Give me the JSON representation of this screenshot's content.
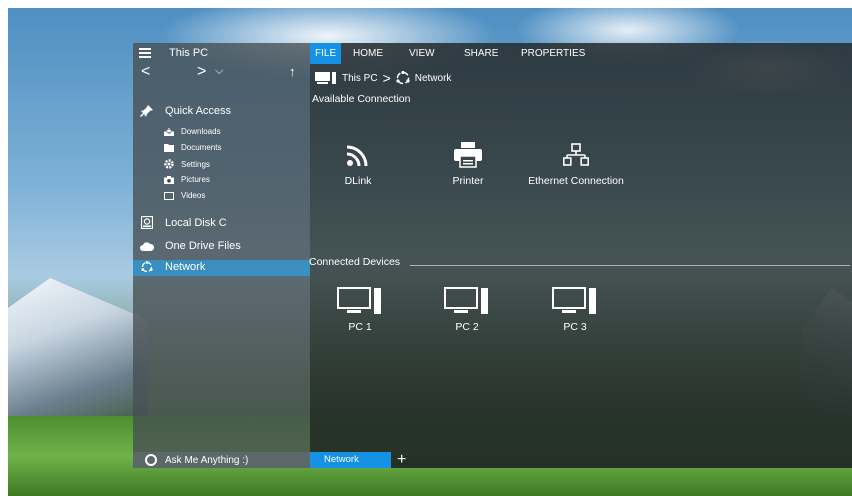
{
  "window": {
    "title": "This PC"
  },
  "nav": {
    "back": "<",
    "forward": ">",
    "history": "⌵",
    "up": "↑"
  },
  "sidebar": {
    "quick_access": "Quick Access",
    "quick_items": [
      {
        "label": "Downloads",
        "icon": "download-icon"
      },
      {
        "label": "Documents",
        "icon": "folder-icon"
      },
      {
        "label": "Settings",
        "icon": "gear-icon"
      },
      {
        "label": "Pictures",
        "icon": "camera-icon"
      },
      {
        "label": "Videos",
        "icon": "video-icon"
      }
    ],
    "local_disk": "Local Disk C",
    "one_drive": "One Drive Files",
    "network": "Network",
    "search_placeholder": "Ask Me Anything :)"
  },
  "menu": {
    "file": "FILE",
    "home": "HOME",
    "view": "VIEW",
    "share": "SHARE",
    "properties": "PROPERTIES"
  },
  "breadcrumb": {
    "root": "This PC",
    "separator": ">",
    "current": "Network"
  },
  "available": {
    "title": "Available Connection",
    "items": [
      {
        "label": "DLink",
        "icon": "wifi-icon"
      },
      {
        "label": "Printer",
        "icon": "printer-icon"
      },
      {
        "label": "Ethernet Connection",
        "icon": "ethernet-icon"
      }
    ]
  },
  "connected": {
    "title": "Connected Devices",
    "items": [
      {
        "label": "PC 1",
        "icon": "pc-icon"
      },
      {
        "label": "PC 2",
        "icon": "pc-icon"
      },
      {
        "label": "PC 3",
        "icon": "pc-icon"
      }
    ]
  },
  "tabs": {
    "active": "Network",
    "add": "+"
  },
  "colors": {
    "accent": "#1592e6",
    "selected": "#3a8fc0"
  }
}
